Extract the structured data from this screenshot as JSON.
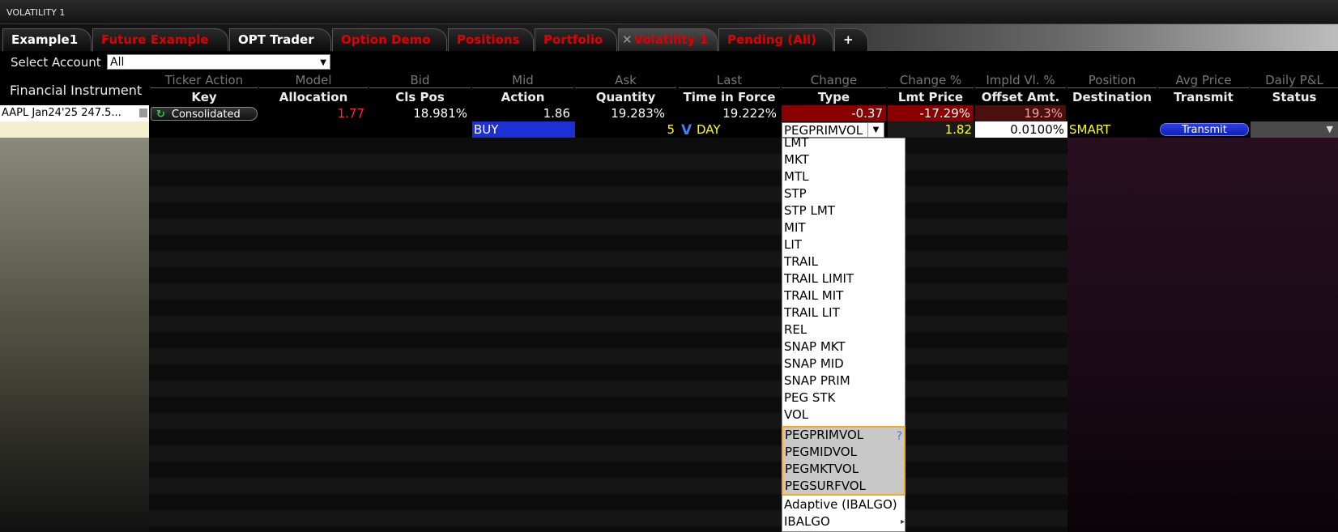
{
  "window_title": "VOLATILITY 1",
  "tabs": [
    {
      "label": "Example1",
      "color": "white"
    },
    {
      "label": "Future Example",
      "color": "red"
    },
    {
      "label": "OPT Trader",
      "color": "white"
    },
    {
      "label": "Option Demo",
      "color": "red"
    },
    {
      "label": "Positions",
      "color": "red"
    },
    {
      "label": "Portfolio",
      "color": "red"
    },
    {
      "label": "Volatility 1",
      "color": "red",
      "active": true,
      "close_glyph": "✕"
    },
    {
      "label": "Pending (All)",
      "color": "red"
    },
    {
      "label": "+",
      "color": "white"
    }
  ],
  "account": {
    "label": "Select Account",
    "value": "All"
  },
  "financial_instrument_label": "Financial Instrument",
  "header_top": [
    "Ticker Action",
    "Model",
    "Bid",
    "Mid",
    "Ask",
    "Last",
    "Change",
    "Change %",
    "Impld Vl. %",
    "Position",
    "Avg Price",
    "Daily P&L"
  ],
  "header_bottom": [
    "Key",
    "Allocation",
    "Cls Pos",
    "Action",
    "Quantity",
    "Time in Force",
    "Type",
    "Lmt Price",
    "Offset Amt.",
    "Destination",
    "Transmit",
    "Status"
  ],
  "row1": {
    "instrument": "AAPL Jan24'25 247.5...",
    "exchange": "Consolidated",
    "model": "1.77",
    "bid": "18.981%",
    "mid": "1.86",
    "ask": "19.283%",
    "last": "19.222%",
    "change": "-0.37",
    "change_pct": "-17.29%",
    "impld_vol": "19.3%"
  },
  "row2": {
    "action": "BUY",
    "quantity": "5",
    "tif": "DAY",
    "type": "PEGPRIMVOL",
    "lmt_price": "1.82",
    "offset": "0.0100%",
    "destination": "SMART",
    "transmit": "Transmit"
  },
  "order_types": [
    "LMT",
    "MKT",
    "MTL",
    "STP",
    "STP LMT",
    "MIT",
    "LIT",
    "TRAIL",
    "TRAIL LIMIT",
    "TRAIL MIT",
    "TRAIL LIT",
    "REL",
    "SNAP MKT",
    "SNAP MID",
    "SNAP PRIM",
    "PEG STK",
    "VOL"
  ],
  "order_types_highlighted": [
    "PEGPRIMVOL",
    "PEGMIDVOL",
    "PEGMKTVOL",
    "PEGSURFVOL"
  ],
  "order_types_extra": [
    "Adaptive (IBALGO)",
    "IBALGO"
  ],
  "help_glyph": "?",
  "colors": {
    "red_tab": "#e00000",
    "yellow_value": "#ffff00",
    "buy_bg": "#1f2fd6",
    "highlight_border": "#f5a623"
  }
}
